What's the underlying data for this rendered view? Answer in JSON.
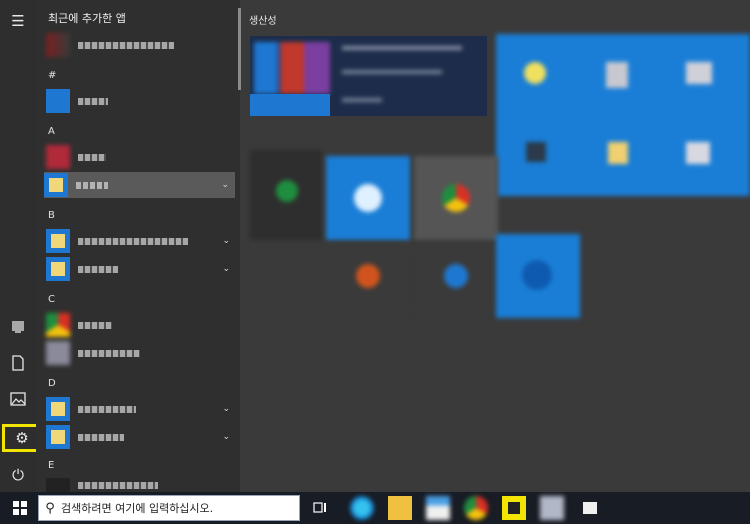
{
  "app_list": {
    "header": "최근에 추가한 앱",
    "letters": [
      "#",
      "A",
      "B",
      "C",
      "D",
      "E"
    ]
  },
  "tiles_header": "생산성",
  "rail": {
    "menu_icon": "☰",
    "settings_icon": "⚙",
    "power_icon": "⏻"
  },
  "taskbar": {
    "search_placeholder": "검색하려면 여기에 입력하십시오.",
    "search_icon": "⚲"
  }
}
